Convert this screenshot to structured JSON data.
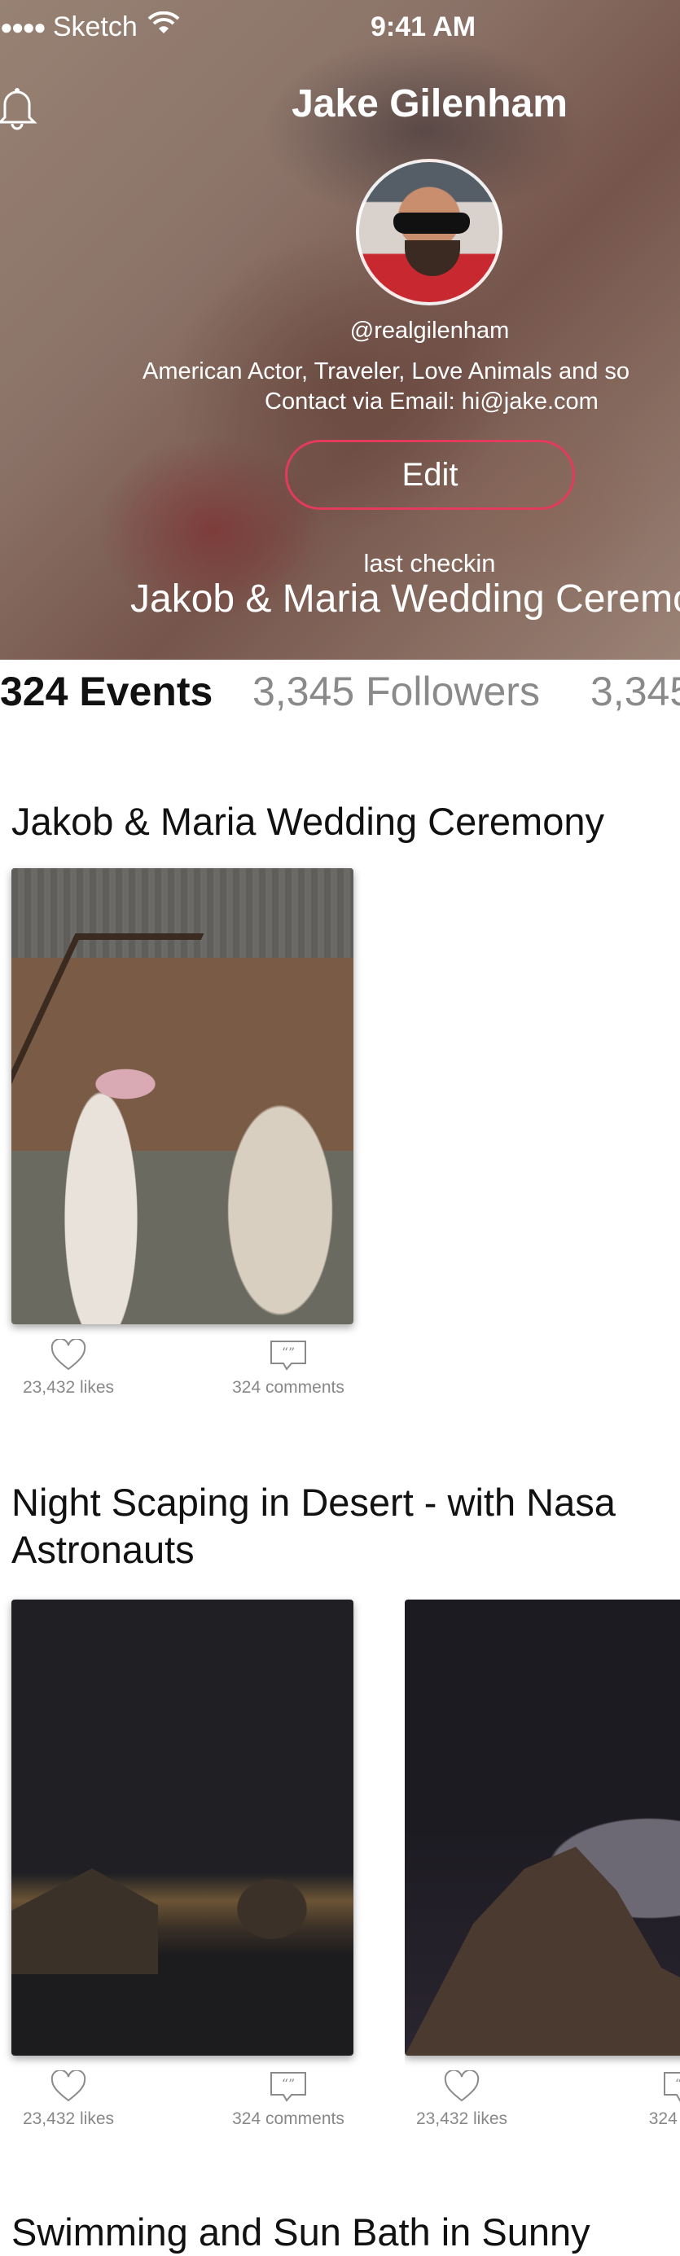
{
  "status_bar": {
    "carrier": "Sketch",
    "time": "9:41 AM"
  },
  "profile": {
    "name": "Jake Gilenham",
    "handle": "@realgilenham",
    "bio_line1": "American Actor, Traveler, Love Animals and so",
    "bio_line2": "Contact via Email: hi@jake.com",
    "edit_label": "Edit",
    "checkin_label": "last checkin",
    "checkin_event": "Jakob & Maria Wedding Ceremo"
  },
  "stats": {
    "events": "324 Events",
    "followers": "3,345 Followers",
    "third": "3,345"
  },
  "colors": {
    "accent": "#e23b5b",
    "muted_text": "#8a8a8a"
  },
  "events": [
    {
      "title": "Jakob & Maria Wedding Ceremony",
      "cards": [
        {
          "likes": "23,432 likes",
          "comments": "324 comments"
        }
      ]
    },
    {
      "title": "Night Scaping in Desert - with Nasa Astronauts",
      "cards": [
        {
          "likes": "23,432 likes",
          "comments": "324 comments"
        },
        {
          "likes": "23,432 likes",
          "comments": "324 com"
        }
      ]
    },
    {
      "title": "Swimming and Sun Bath in Sunny",
      "cards": []
    }
  ]
}
